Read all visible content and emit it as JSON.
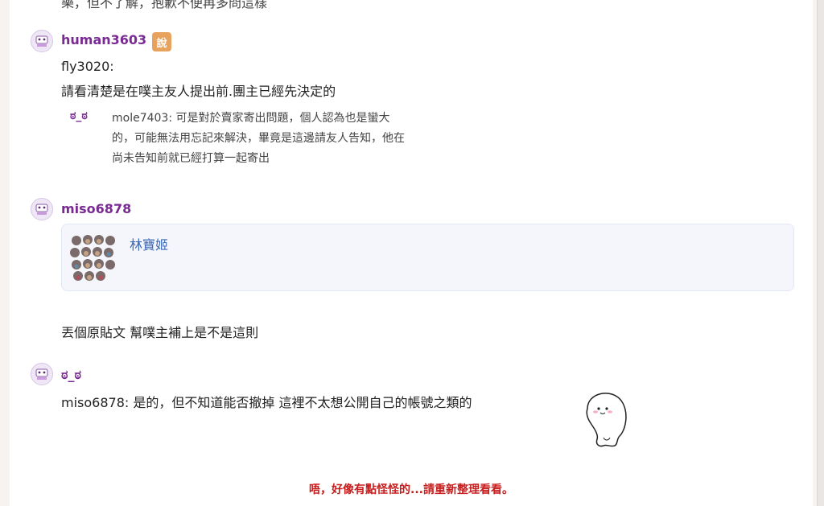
{
  "top_cut_text": "樂，但不了解，抱歉不便再多問這樣",
  "posts": [
    {
      "username": "human3603",
      "badge_text": "說",
      "lines": [
        "fly3020:",
        "請看清楚是在噗主友人提出前.團主已經先決定的"
      ],
      "quote": {
        "name": "ಠ_ಠ",
        "text_lines": [
          "mole7403: 可是對於賣家寄出問題，個人認為也是蠻大",
          "的，可能無法用忘記來解決，畢竟是這邊請友人告知，他在",
          "尚未告知前就已經打算一起寄出"
        ]
      }
    },
    {
      "username": "miso6878",
      "card": {
        "link_text": "林寶姬"
      },
      "line": "丟個原貼文 幫噗主補上是不是這則"
    },
    {
      "username": "ಠ_ಠ",
      "line": "miso6878: 是的，但不知道能否撤掉 這裡不太想公開自己的帳號之類的"
    }
  ],
  "error_message": "唔，好像有點怪怪的...請重新整理看看。"
}
